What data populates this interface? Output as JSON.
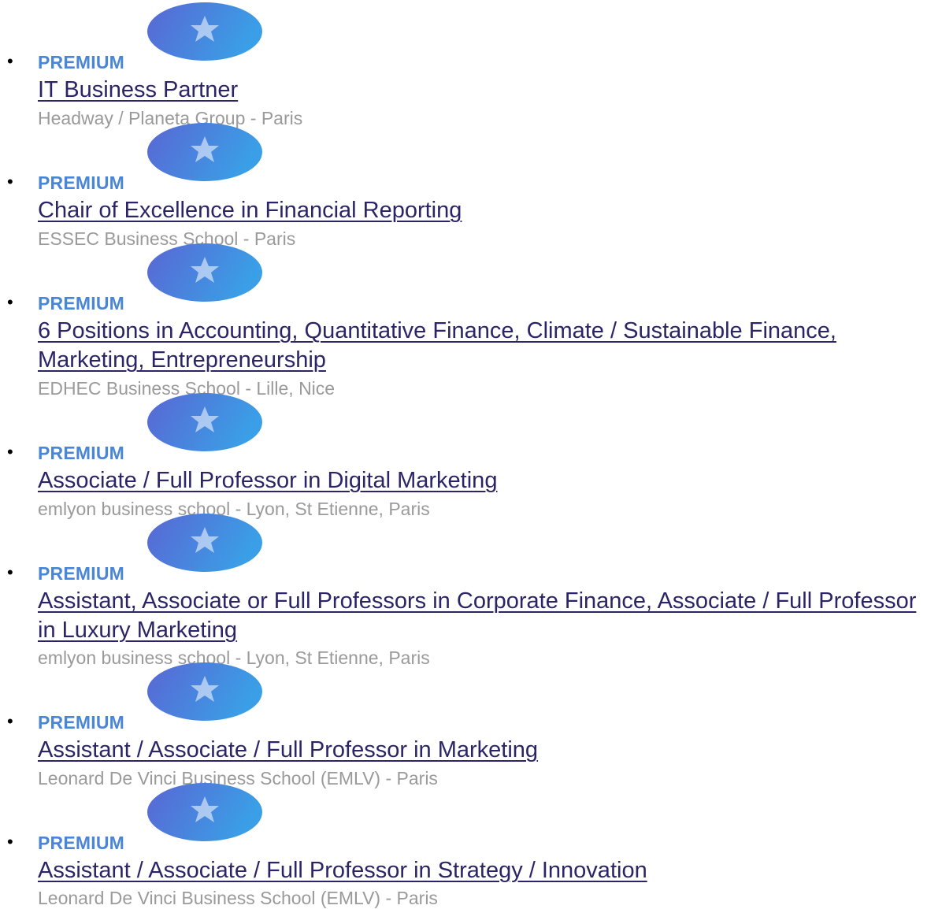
{
  "colors": {
    "premium": "#4a86d8",
    "title_link": "#2b2466",
    "org_text": "#9a9a9a",
    "badge_gradient_start": "#5b6fd6",
    "badge_gradient_end": "#3aa0e8"
  },
  "badge_icon": "star-icon",
  "jobs": [
    {
      "premium_label": "PREMIUM",
      "title": "IT Business Partner",
      "org": "Headway / Planeta Group - Paris"
    },
    {
      "premium_label": "PREMIUM",
      "title": "Chair of Excellence in Financial Reporting",
      "org": "ESSEC Business School - Paris"
    },
    {
      "premium_label": "PREMIUM",
      "title": "6 Positions in Accounting, Quantitative Finance, Climate / Sustainable Finance, Marketing, Entrepreneurship",
      "org": "EDHEC Business School - Lille, Nice"
    },
    {
      "premium_label": "PREMIUM",
      "title": "Associate / Full Professor in Digital Marketing",
      "org": "emlyon business school - Lyon, St Etienne, Paris"
    },
    {
      "premium_label": "PREMIUM",
      "title": "Assistant, Associate or Full Professors in Corporate Finance, Associate / Full Professor in Luxury Marketing",
      "org": "emlyon business school - Lyon, St Etienne, Paris"
    },
    {
      "premium_label": "PREMIUM",
      "title": "Assistant / Associate / Full Professor in Marketing",
      "org": "Leonard De Vinci Business School (EMLV) - Paris"
    },
    {
      "premium_label": "PREMIUM",
      "title": "Assistant / Associate / Full Professor in Strategy / Innovation",
      "org": "Leonard De Vinci Business School (EMLV) - Paris"
    }
  ]
}
